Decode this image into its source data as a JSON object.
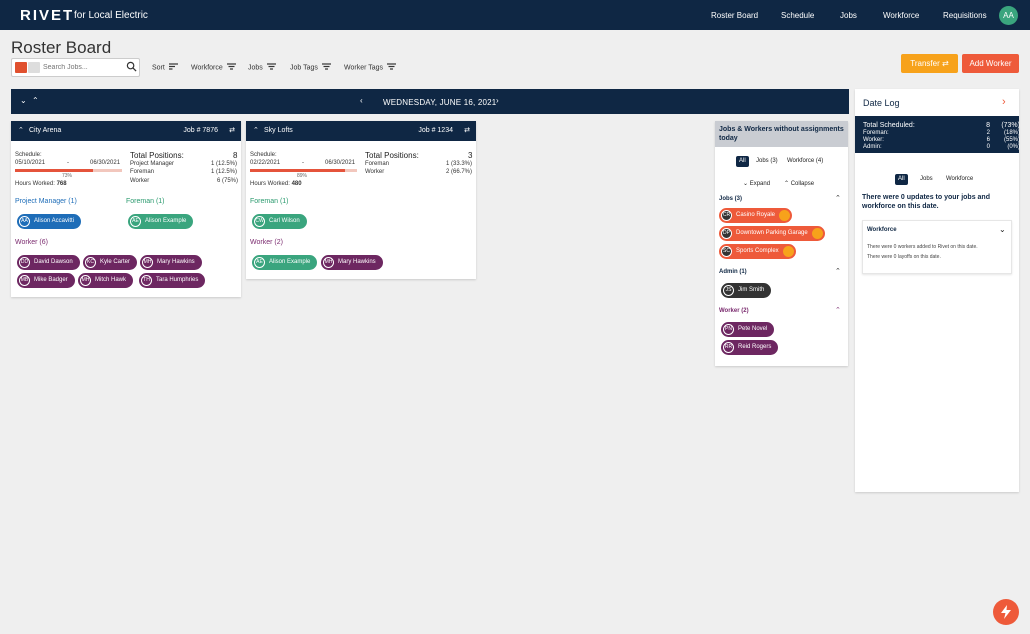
{
  "header": {
    "brand": "RIVET",
    "brand_sub": "for Local Electric",
    "nav": [
      "Roster Board",
      "Schedule",
      "Jobs",
      "Workforce",
      "Requisitions"
    ],
    "avatar": "AA"
  },
  "page_title": "Roster Board",
  "toolbar": {
    "search_placeholder": "Search Jobs...",
    "filters": [
      "Sort",
      "Workforce",
      "Jobs",
      "Job Tags",
      "Worker Tags"
    ],
    "transfer_label": "Transfer",
    "add_worker_label": "Add Worker"
  },
  "datebar": {
    "date": "WEDNESDAY, JUNE 16, 2021"
  },
  "jobs": [
    {
      "name": "City Arena",
      "job_no": "Job # 7876",
      "schedule_label": "Schedule:",
      "start": "05/10/2021",
      "dash": "-",
      "end": "06/30/2021",
      "progress": "73%",
      "progress_value": 0.73,
      "hours_label": "Hours Worked:",
      "hours": "768",
      "total_label": "Total Positions:",
      "total": "8",
      "positions": [
        {
          "role": "Project Manager",
          "count": "1 (12.5%)"
        },
        {
          "role": "Foreman",
          "count": "1 (12.5%)"
        },
        {
          "role": "Worker",
          "count": "6 (75%)"
        }
      ],
      "pm_title": "Project Manager (1)",
      "pm": [
        {
          "ini": "AA",
          "name": "Alison Accavitti"
        }
      ],
      "foreman_title": "Foreman (1)",
      "foreman": [
        {
          "ini": "AE",
          "name": "Alison Example"
        }
      ],
      "worker_title": "Worker (6)",
      "workers": [
        {
          "ini": "DD",
          "name": "David Dawson"
        },
        {
          "ini": "KC",
          "name": "Kyle Carter"
        },
        {
          "ini": "MH",
          "name": "Mary Hawkins"
        },
        {
          "ini": "MB",
          "name": "Mike Badger"
        },
        {
          "ini": "MH",
          "name": "Mitch Hawk"
        },
        {
          "ini": "TH",
          "name": "Tara Humphries"
        }
      ]
    },
    {
      "name": "Sky Lofts",
      "job_no": "Job # 1234",
      "schedule_label": "Schedule:",
      "start": "02/22/2021",
      "dash": "-",
      "end": "06/30/2021",
      "progress": "89%",
      "progress_value": 0.89,
      "hours_label": "Hours Worked:",
      "hours": "480",
      "total_label": "Total Positions:",
      "total": "3",
      "positions": [
        {
          "role": "Foreman",
          "count": "1 (33.3%)"
        },
        {
          "role": "Worker",
          "count": "2 (66.7%)"
        }
      ],
      "foreman_title": "Foreman (1)",
      "foreman": [
        {
          "ini": "CW",
          "name": "Carl Wilson"
        }
      ],
      "worker_title": "Worker (2)",
      "workers": [
        {
          "ini": "AE",
          "name": "Alison Example"
        },
        {
          "ini": "MH",
          "name": "Mary Hawkins"
        }
      ]
    }
  ],
  "unassigned": {
    "title": "Jobs & Workers without assignments today",
    "tabs": [
      "All",
      "Jobs (3)",
      "Workforce (4)"
    ],
    "expand": "Expand",
    "collapse": "Collapse",
    "jobs_title": "Jobs (3)",
    "jobs": [
      {
        "ini": "CR",
        "name": "Casino Royale"
      },
      {
        "ini": "DP",
        "name": "Downtown Parking Garage"
      },
      {
        "ini": "SC",
        "name": "Sports Complex"
      }
    ],
    "admin_title": "Admin (1)",
    "admins": [
      {
        "ini": "JS",
        "name": "Jim Smith"
      }
    ],
    "worker_title": "Worker (2)",
    "workers": [
      {
        "ini": "PN",
        "name": "Pete Novel"
      },
      {
        "ini": "RR",
        "name": "Reid Rogers"
      }
    ]
  },
  "datelog": {
    "title": "Date Log",
    "summary": [
      {
        "k": "Total Scheduled:",
        "v": "8",
        "p": "(73%)"
      },
      {
        "k": "Foreman:",
        "v": "2",
        "p": "(18%)"
      },
      {
        "k": "Worker:",
        "v": "6",
        "p": "(55%)"
      },
      {
        "k": "Admin:",
        "v": "0",
        "p": "(0%)"
      }
    ],
    "tabs": [
      "All",
      "Jobs",
      "Workforce"
    ],
    "message": "There were 0 updates to your jobs and workforce on this date.",
    "wf_title": "Workforce",
    "wf_lines": [
      "There were 0 workers added to Rivet on this date.",
      "There were 0 layoffs on this date."
    ]
  },
  "colors": {
    "navy": "#0f2744",
    "orange": "#f7a21b",
    "red": "#ee5a3a",
    "blue": "#1e6db8",
    "green": "#3aa57e",
    "purple": "#6d2761"
  }
}
